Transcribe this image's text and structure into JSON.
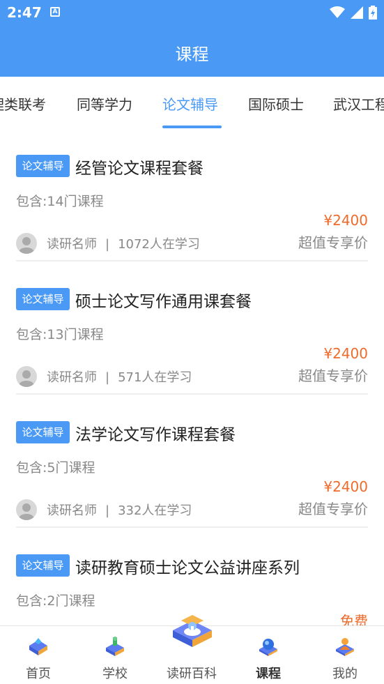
{
  "status": {
    "time": "2:47",
    "a_label": "A"
  },
  "header": {
    "title": "课程"
  },
  "tabs": [
    {
      "label": "理类联考"
    },
    {
      "label": "同等学力"
    },
    {
      "label": "论文辅导"
    },
    {
      "label": "国际硕士"
    },
    {
      "label": "武汉工程"
    }
  ],
  "courses": [
    {
      "badge": "论文辅导",
      "title": "经管论文课程套餐",
      "count": "包含:14门课程",
      "price": "¥2400",
      "price_note": "超值专享价",
      "teacher": "读研名师",
      "sep": "|",
      "students": "1072人在学习"
    },
    {
      "badge": "论文辅导",
      "title": "硕士论文写作通用课套餐",
      "count": "包含:13门课程",
      "price": "¥2400",
      "price_note": "超值专享价",
      "teacher": "读研名师",
      "sep": "|",
      "students": "571人在学习"
    },
    {
      "badge": "论文辅导",
      "title": "法学论文写作课程套餐",
      "count": "包含:5门课程",
      "price": "¥2400",
      "price_note": "超值专享价",
      "teacher": "读研名师",
      "sep": "|",
      "students": "332人在学习"
    },
    {
      "badge": "论文辅导",
      "title": "读研教育硕士论文公益讲座系列",
      "count": "包含:2门课程",
      "price": "免费"
    }
  ],
  "nav": [
    {
      "label": "首页",
      "icon": "home-icon"
    },
    {
      "label": "学校",
      "icon": "school-icon"
    },
    {
      "label": "读研百科",
      "icon": "encyclopedia-icon"
    },
    {
      "label": "课程",
      "icon": "course-icon"
    },
    {
      "label": "我的",
      "icon": "profile-icon"
    }
  ],
  "colors": {
    "primary": "#4a9af5",
    "price": "#ef6b2b"
  }
}
